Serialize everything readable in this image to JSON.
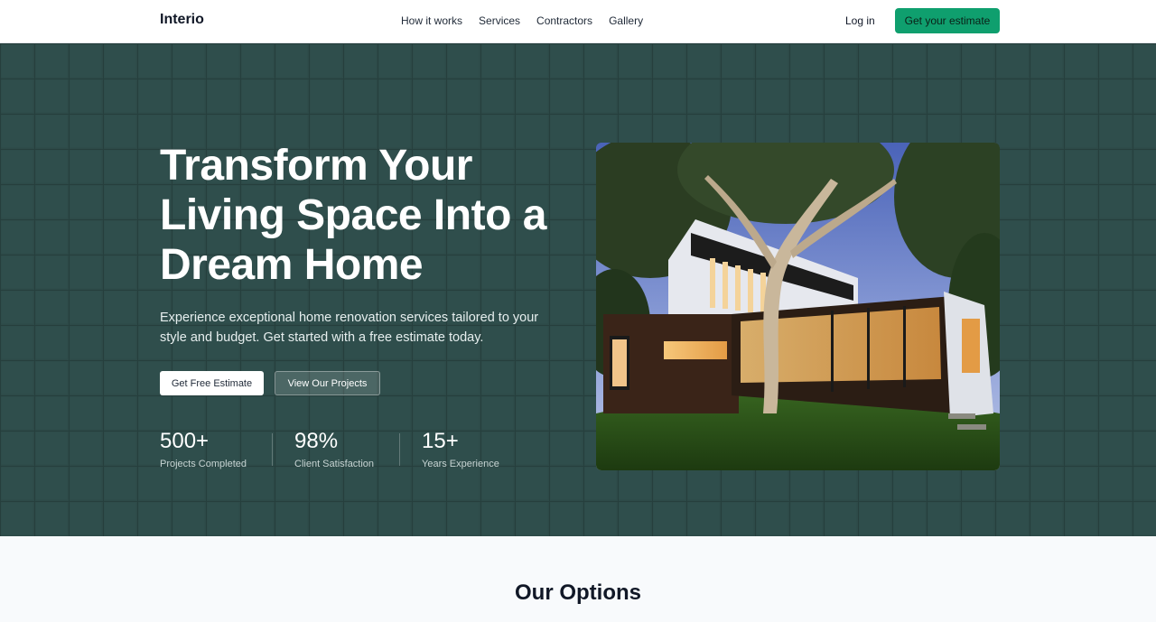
{
  "header": {
    "brand": "Interio",
    "nav": [
      "How it works",
      "Services",
      "Contractors",
      "Gallery"
    ],
    "login": "Log in",
    "cta": "Get your estimate"
  },
  "hero": {
    "title_lines": [
      "Transform Your",
      "Living Space Into a",
      "Dream Home"
    ],
    "subtitle": "Experience exceptional home renovation services tailored to your style and budget. Get started with a free estimate today.",
    "primary_button": "Get Free Estimate",
    "secondary_button": "View Our Projects",
    "stats": [
      {
        "value": "500+",
        "label": "Projects Completed"
      },
      {
        "value": "98%",
        "label": "Client Satisfaction"
      },
      {
        "value": "15+",
        "label": "Years Experience"
      }
    ],
    "image_icon": "modern-house-photo"
  },
  "options": {
    "title": "Our Options"
  },
  "colors": {
    "hero_bg": "#2d4a48",
    "accent": "#0f9f6e"
  }
}
